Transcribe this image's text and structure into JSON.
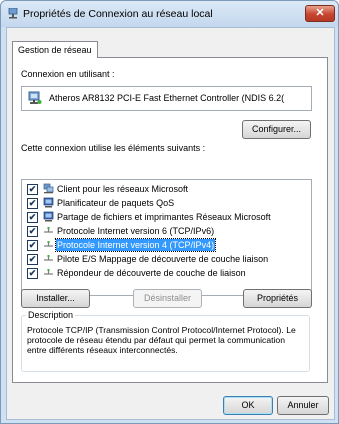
{
  "window": {
    "title": "Propriétés de Connexion au réseau local",
    "close_label": "✕"
  },
  "tabs": [
    {
      "label": "Gestion de réseau"
    }
  ],
  "connect_using": {
    "label": "Connexion en utilisant :",
    "adapter": "Atheros AR8132 PCI-E Fast Ethernet Controller (NDIS 6.2(",
    "configure_label": "Configurer..."
  },
  "components": {
    "label": "Cette connexion utilise les éléments suivants :",
    "items": [
      {
        "label": "Client pour les réseaux Microsoft",
        "checked": true,
        "icon": "network-client-icon"
      },
      {
        "label": "Planificateur de paquets QoS",
        "checked": true,
        "icon": "network-service-icon"
      },
      {
        "label": "Partage de fichiers et imprimantes Réseaux Microsoft",
        "checked": true,
        "icon": "network-service-icon"
      },
      {
        "label": "Protocole Internet version 6 (TCP/IPv6)",
        "checked": true,
        "icon": "protocol-icon"
      },
      {
        "label": "Protocole Internet version 4 (TCP/IPv4)",
        "checked": true,
        "icon": "protocol-icon",
        "selected": true
      },
      {
        "label": "Pilote E/S Mappage de découverte de couche liaison",
        "checked": true,
        "icon": "protocol-icon"
      },
      {
        "label": "Répondeur de découverte de couche de liaison",
        "checked": true,
        "icon": "protocol-icon"
      }
    ],
    "check_mark": "✔"
  },
  "actions": {
    "install": "Installer...",
    "uninstall": "Désinstaller",
    "properties": "Propriétés"
  },
  "description": {
    "legend": "Description",
    "text": "Protocole TCP/IP (Transmission Control Protocol/Internet Protocol). Le protocole de réseau étendu par défaut qui permet la communication entre différents réseaux interconnectés."
  },
  "footer": {
    "ok": "OK",
    "cancel": "Annuler"
  }
}
